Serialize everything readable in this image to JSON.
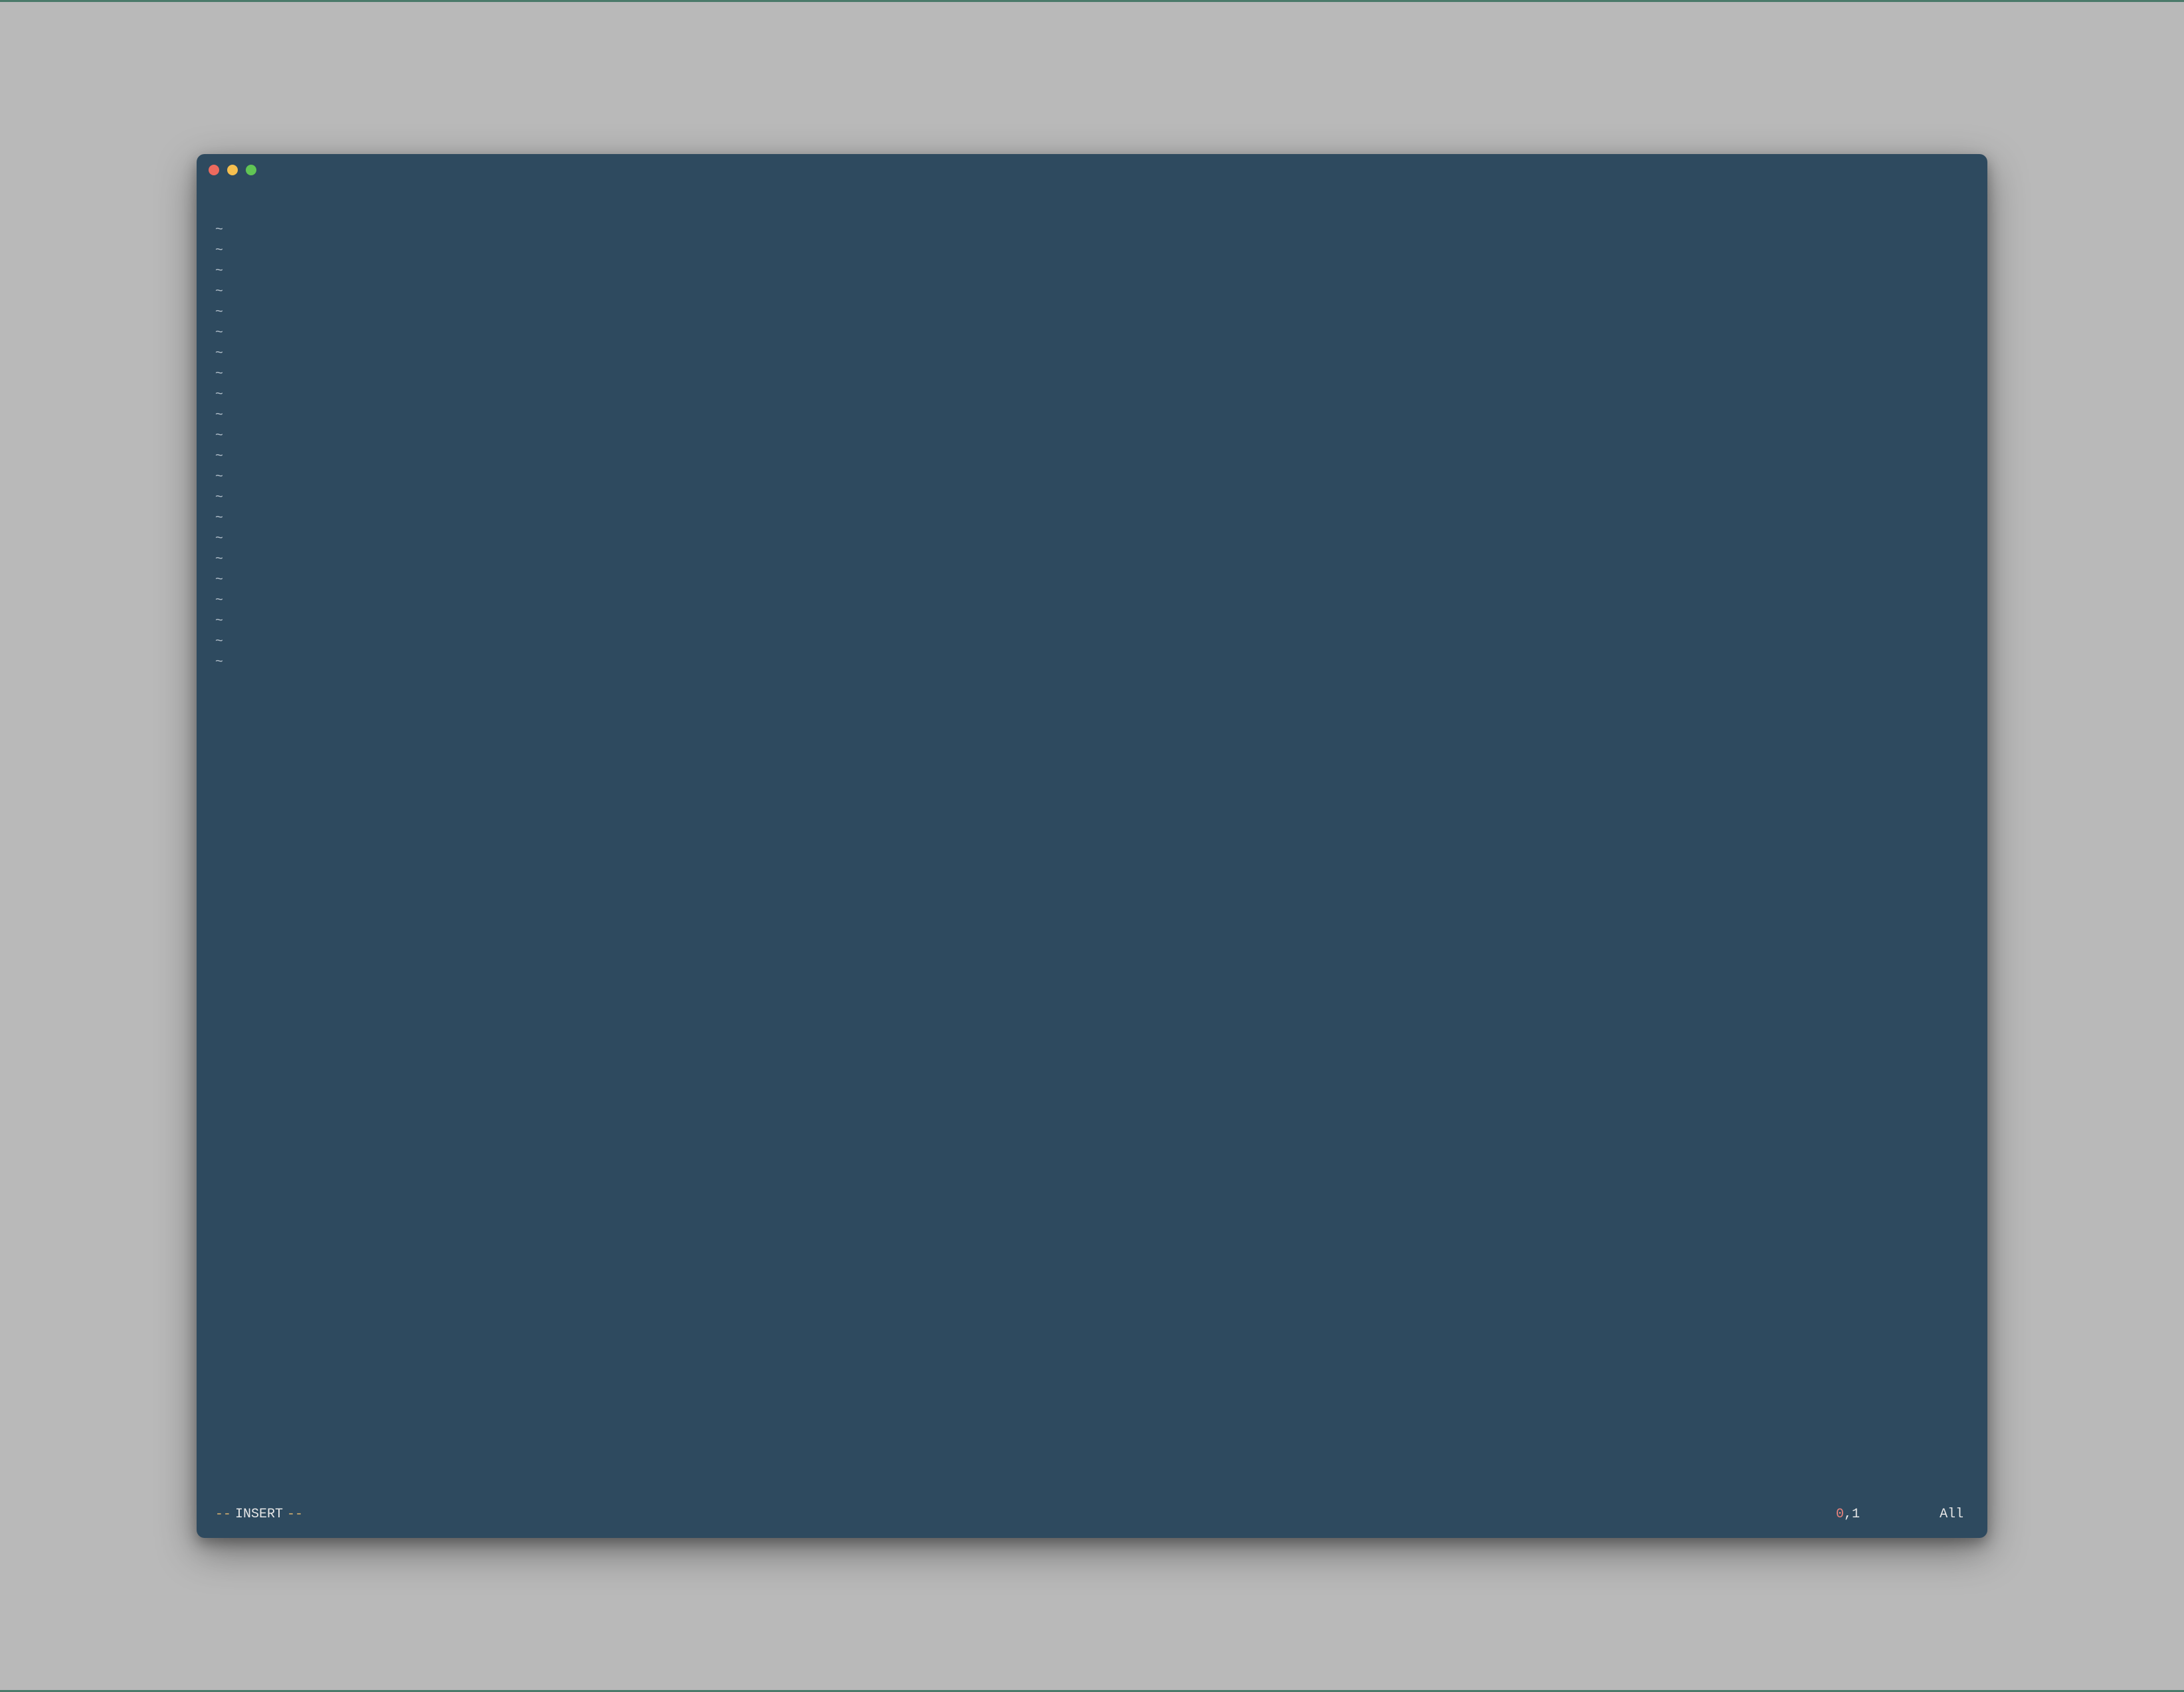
{
  "editor": {
    "empty_line_marker": "~",
    "tilde_count": 22,
    "first_line_content": ""
  },
  "status": {
    "dash_left": "--",
    "mode_label": "INSERT",
    "dash_right": "--",
    "cursor_row": "0",
    "cursor_sep": ",",
    "cursor_col": "1",
    "scroll_indicator": "All"
  },
  "colors": {
    "bg": "#2e4a5f",
    "page_bg": "#b9b9b9",
    "text": "#c8d3dc",
    "accent_yellow": "#d9b26f",
    "accent_red": "#e8827b"
  }
}
